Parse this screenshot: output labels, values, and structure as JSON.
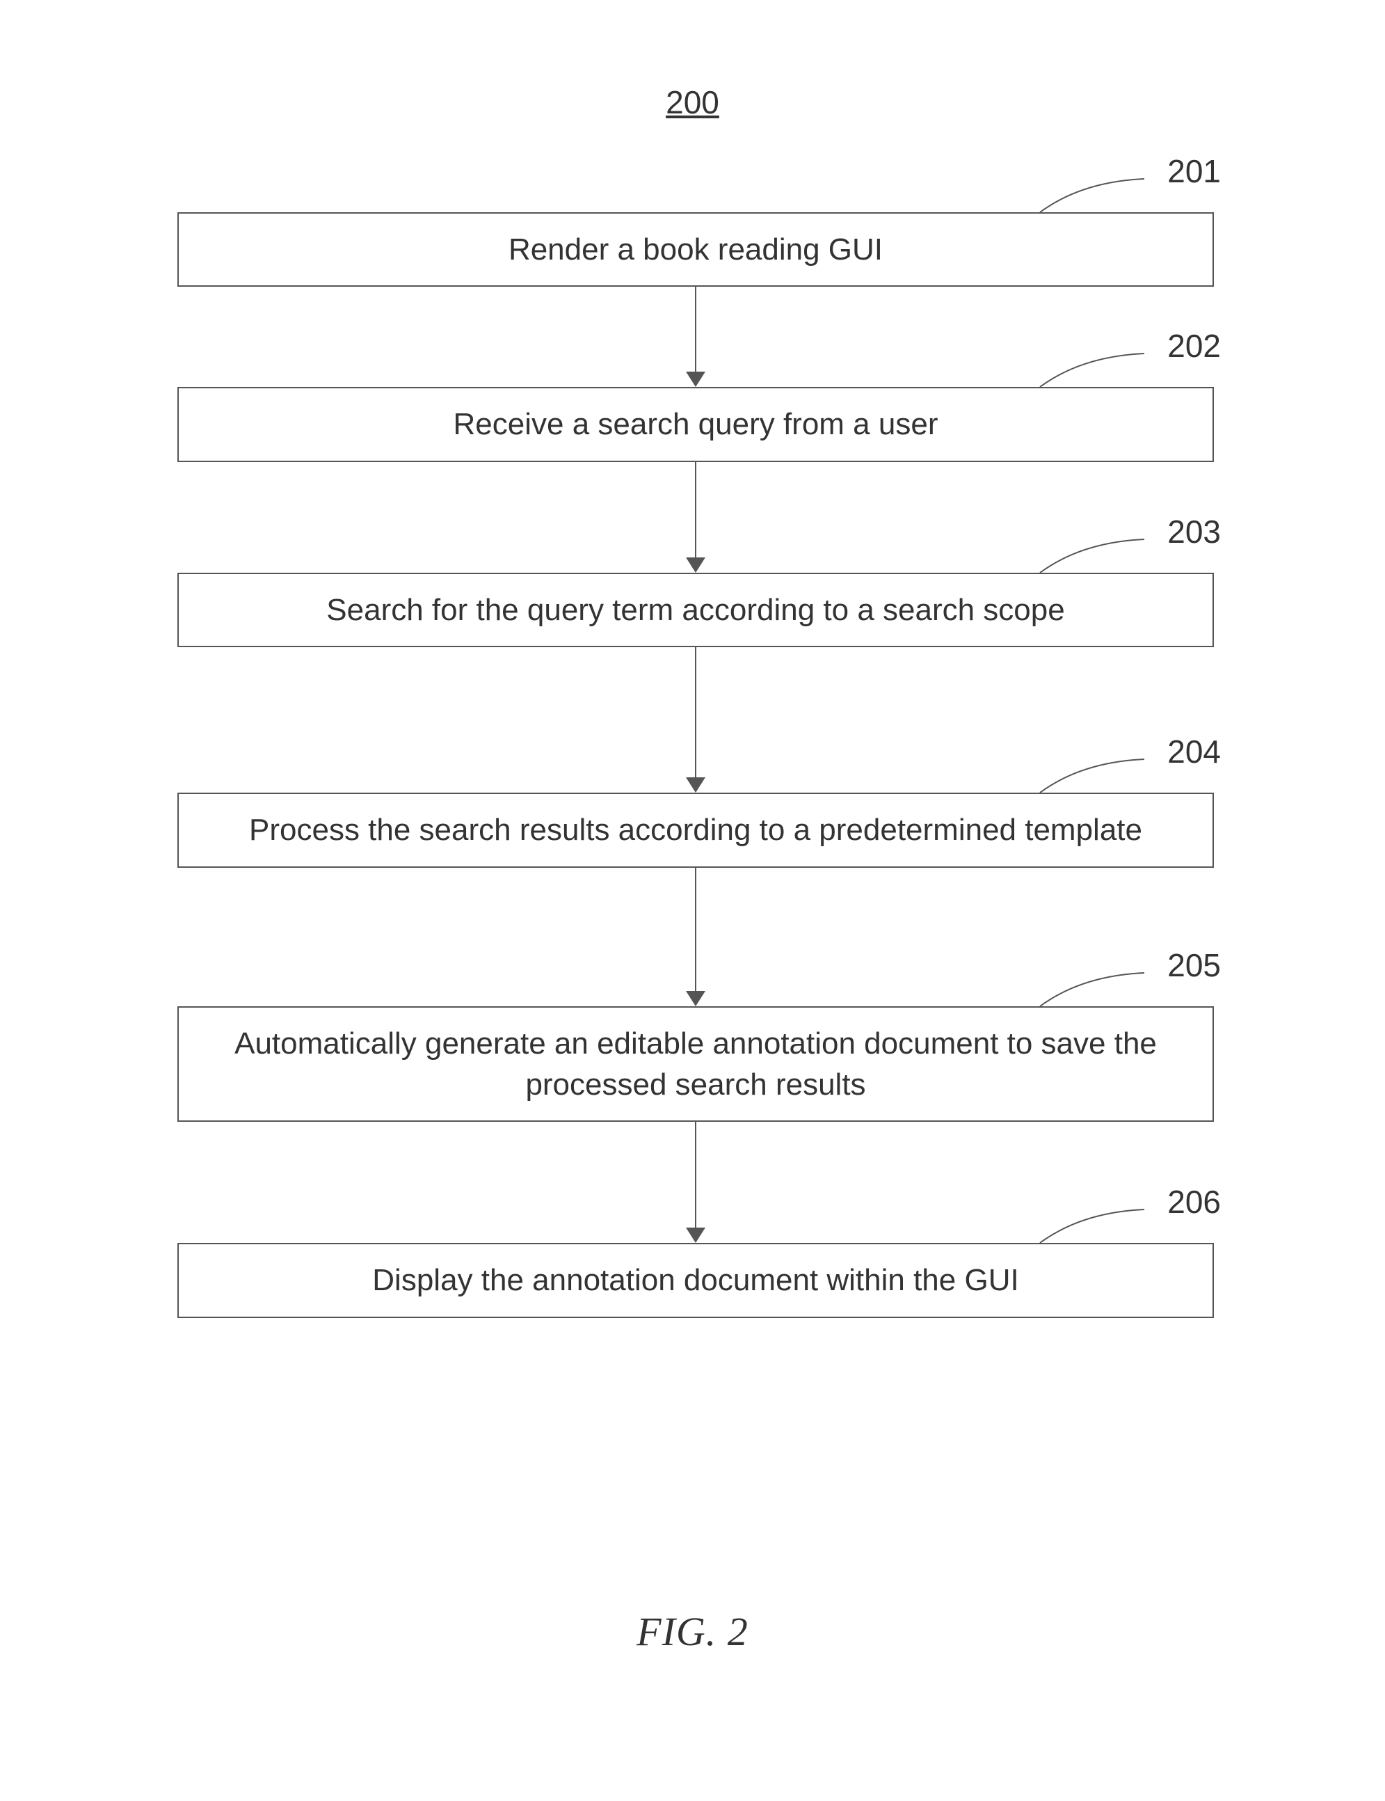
{
  "diagram_number": "200",
  "figure_caption": "FIG. 2",
  "steps": [
    {
      "ref": "201",
      "text": "Render a book reading GUI",
      "arrow_after_height": 145
    },
    {
      "ref": "202",
      "text": "Receive a search query from a user",
      "arrow_after_height": 160
    },
    {
      "ref": "203",
      "text": "Search for the query term according to a search scope",
      "arrow_after_height": 210
    },
    {
      "ref": "204",
      "text": "Process the search results according to a predetermined template",
      "arrow_after_height": 200
    },
    {
      "ref": "205",
      "text": "Automatically generate an editable annotation document to save the processed search results",
      "arrow_after_height": 175
    },
    {
      "ref": "206",
      "text": "Display the annotation document within the GUI",
      "arrow_after_height": 0
    }
  ]
}
